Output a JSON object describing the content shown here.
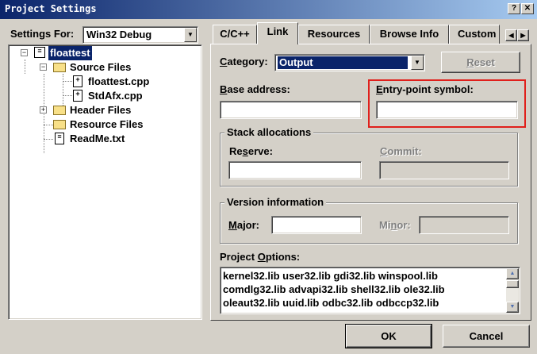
{
  "window": {
    "title": "Project Settings",
    "help_btn": "?",
    "close_btn": "✕"
  },
  "left": {
    "settings_for_label": "Settings For:",
    "config_value": "Win32 Debug",
    "tree": {
      "project": "floattest",
      "source_files": "Source Files",
      "file1": "floattest.cpp",
      "file2": "StdAfx.cpp",
      "header_files": "Header Files",
      "resource_files": "Resource Files",
      "readme": "ReadMe.txt"
    }
  },
  "tabs": [
    "C/C++",
    "Link",
    "Resources",
    "Browse Info",
    "Custom"
  ],
  "link": {
    "category_label": "Category:",
    "category_value": "Output",
    "reset_label": "Reset",
    "base_address_label": "Base address:",
    "base_address_value": "",
    "entry_point_label": "Entry-point symbol:",
    "entry_point_value": "",
    "stack_group": "Stack allocations",
    "reserve_label": "Reserve:",
    "reserve_value": "",
    "commit_label": "Commit:",
    "commit_value": "",
    "version_group": "Version information",
    "major_label": "Major:",
    "major_value": "",
    "minor_label": "Minor:",
    "minor_value": "",
    "project_options_label": "Project Options:",
    "project_options_lines": [
      "kernel32.lib user32.lib gdi32.lib winspool.lib",
      "comdlg32.lib advapi32.lib shell32.lib ole32.lib",
      "oleaut32.lib uuid.lib odbc32.lib odbccp32.lib"
    ]
  },
  "footer": {
    "ok_label": "OK",
    "cancel_label": "Cancel"
  },
  "colors": {
    "highlight_box": "#e0201c",
    "selection": "#0a246a",
    "titlebar": "#0a246a"
  }
}
